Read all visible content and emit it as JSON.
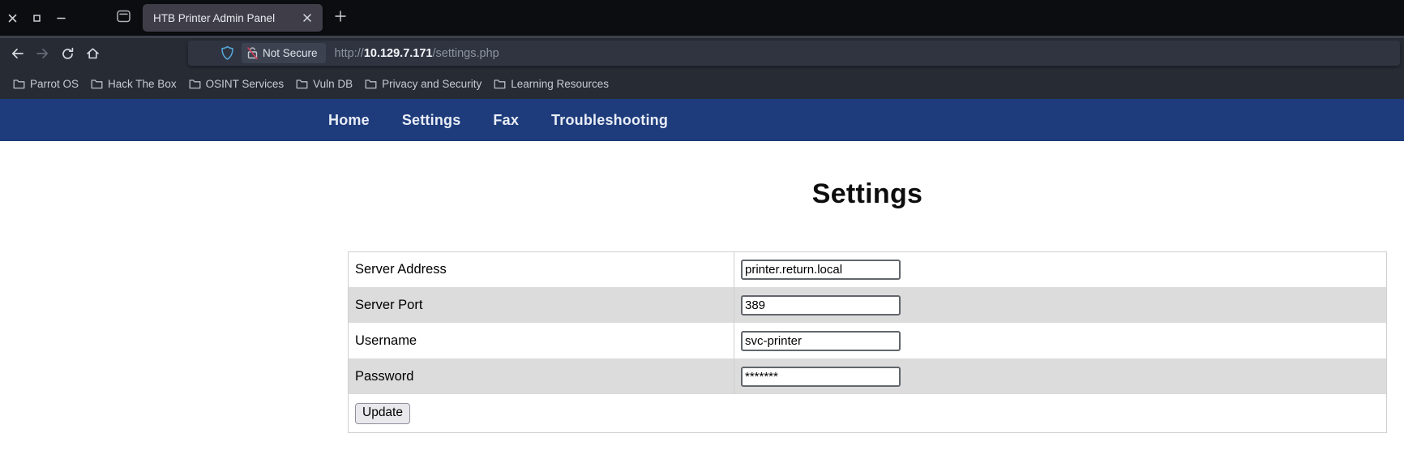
{
  "browser": {
    "tab": {
      "title": "HTB Printer Admin Panel"
    },
    "urlbar": {
      "security_label": "Not Secure",
      "scheme": "http://",
      "host": "10.129.7.171",
      "path": "/settings.php"
    },
    "bookmarks": [
      {
        "label": "Parrot OS"
      },
      {
        "label": "Hack The Box"
      },
      {
        "label": "OSINT Services"
      },
      {
        "label": "Vuln DB"
      },
      {
        "label": "Privacy and Security"
      },
      {
        "label": "Learning Resources"
      }
    ],
    "icons": {
      "shield": "tracking-protection-shield",
      "lock": "broken-lock-not-secure",
      "folder": "bookmark-folder"
    },
    "colors": {
      "shield_blue": "#57a9dd",
      "lock_slash_red": "#cc3d55",
      "navbar_blue": "#1e3c7c"
    }
  },
  "page": {
    "nav": [
      {
        "label": "Home"
      },
      {
        "label": "Settings"
      },
      {
        "label": "Fax"
      },
      {
        "label": "Troubleshooting"
      }
    ],
    "heading": "Settings",
    "form": {
      "rows": [
        {
          "label": "Server Address",
          "value": "printer.return.local"
        },
        {
          "label": "Server Port",
          "value": "389"
        },
        {
          "label": "Username",
          "value": "svc-printer"
        },
        {
          "label": "Password",
          "value": "*******"
        }
      ],
      "submit_label": "Update"
    },
    "row_alt_color": "#dcdcdc"
  }
}
